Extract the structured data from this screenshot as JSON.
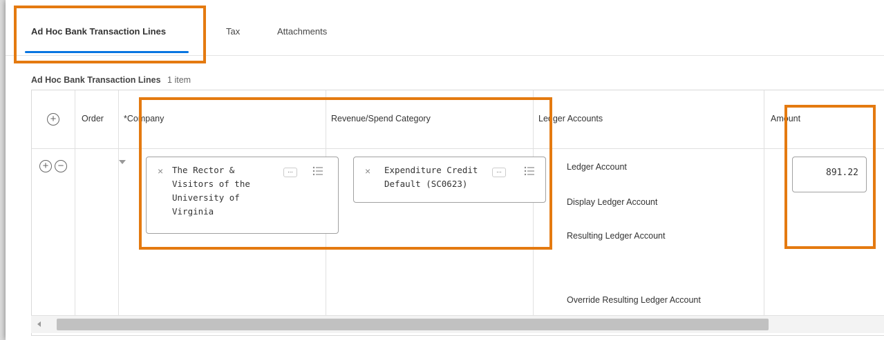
{
  "tabs": [
    {
      "label": "Ad Hoc Bank Transaction Lines",
      "active": true
    },
    {
      "label": "Tax",
      "active": false
    },
    {
      "label": "Attachments",
      "active": false
    }
  ],
  "section": {
    "title": "Ad Hoc Bank Transaction Lines",
    "count": "1 item"
  },
  "table": {
    "headers": {
      "order": "Order",
      "company": "*Company",
      "category": "Revenue/Spend Category",
      "ledger": "Ledger Accounts",
      "amount": "Amount"
    },
    "row": {
      "company": "The Rector &\nVisitors of the\nUniversity of\nVirginia",
      "category": "Expenditure Credit\nDefault (SC0623)",
      "ledger_accounts": [
        "Ledger Account",
        "Display Ledger Account",
        "Resulting Ledger Account",
        "Override Resulting Ledger Account"
      ],
      "amount": "891.22"
    }
  },
  "icons": {
    "add": "add-circle-icon",
    "remove": "remove-circle-icon",
    "clear": "close-icon",
    "more": "more-icon",
    "list": "list-icon"
  },
  "colors": {
    "highlight": "#e47a10",
    "tab_active": "#0875e1"
  }
}
